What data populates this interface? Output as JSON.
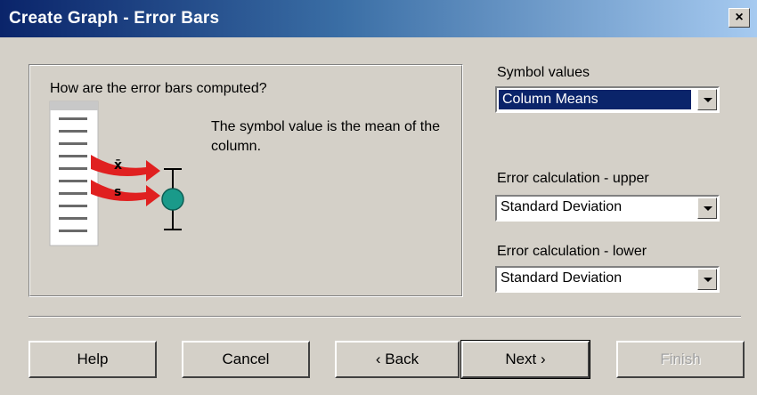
{
  "window": {
    "title": "Create Graph - Error Bars",
    "close_label": "×"
  },
  "panel": {
    "question": "How are the error bars computed?",
    "description": "The symbol value is the mean of the column."
  },
  "symbol_values": {
    "label": "Symbol values",
    "value": "Column Means"
  },
  "error_upper": {
    "label": "Error calculation - upper",
    "value": "Standard Deviation"
  },
  "error_lower": {
    "label": "Error calculation - lower",
    "value": "Standard Deviation"
  },
  "buttons": {
    "help": "Help",
    "cancel": "Cancel",
    "back": "‹ Back",
    "next": "Next ›",
    "finish": "Finish"
  },
  "colors": {
    "title_gradient_start": "#0a246a",
    "selection": "#0a246a",
    "arrow_red": "#e02020",
    "symbol_teal": "#1a9a8a"
  }
}
